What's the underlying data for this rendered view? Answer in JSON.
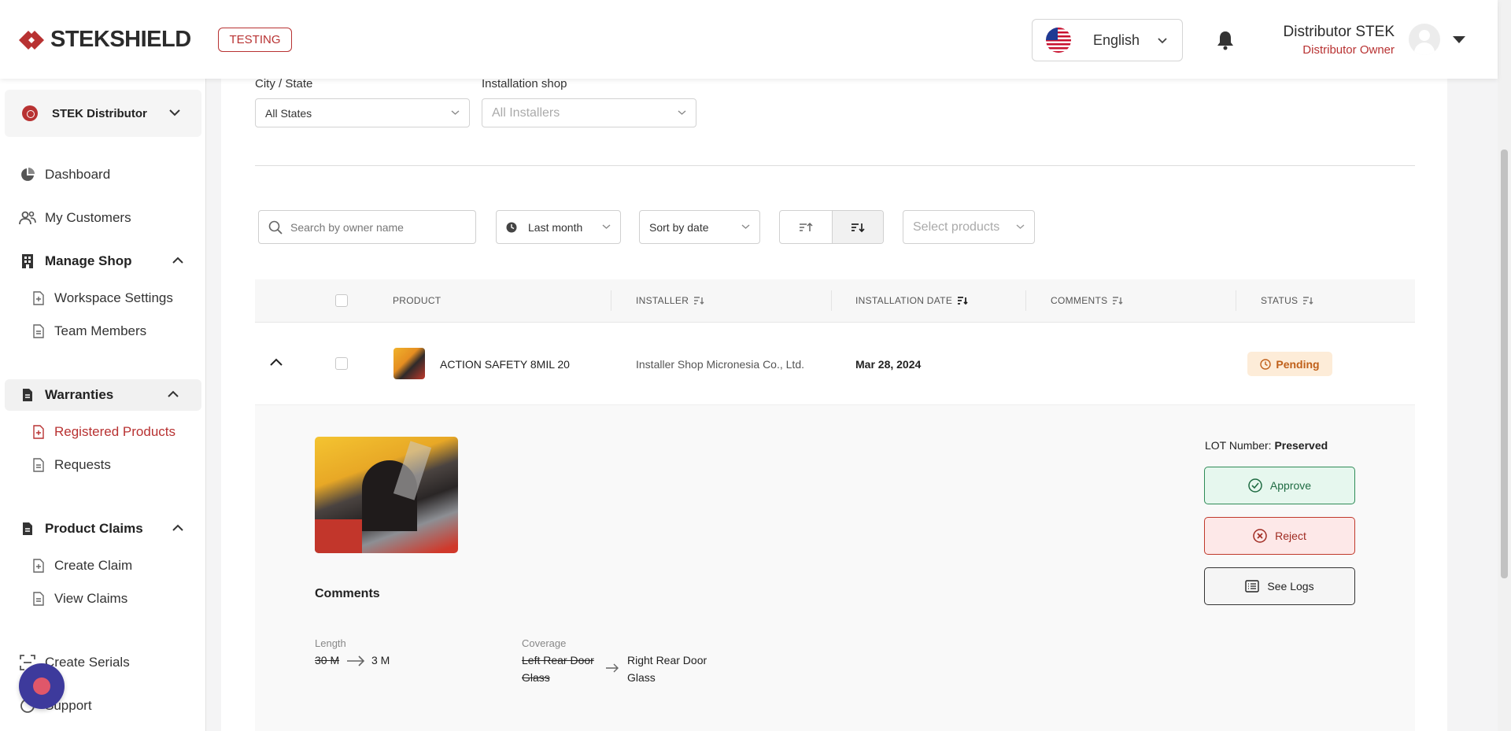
{
  "header": {
    "logo_text": "STEKSHIELD",
    "env_badge": "TESTING",
    "language": "English",
    "user_name": "Distributor STEK",
    "user_role": "Distributor Owner"
  },
  "sidebar": {
    "org_name": "STEK Distributor",
    "items": [
      {
        "label": "Dashboard",
        "icon": "pie-chart-icon"
      },
      {
        "label": "My Customers",
        "icon": "users-icon"
      },
      {
        "label": "Manage Shop",
        "icon": "building-icon"
      },
      {
        "label": "Workspace Settings",
        "icon": "file-plus-icon"
      },
      {
        "label": "Team Members",
        "icon": "file-icon"
      },
      {
        "label": "Warranties",
        "icon": "document-icon"
      },
      {
        "label": "Registered Products",
        "icon": "file-plus-icon"
      },
      {
        "label": "Requests",
        "icon": "file-icon"
      },
      {
        "label": "Product Claims",
        "icon": "document-icon"
      },
      {
        "label": "Create Claim",
        "icon": "file-plus-icon"
      },
      {
        "label": "View Claims",
        "icon": "file-icon"
      },
      {
        "label": "Create Serials",
        "icon": "scan-icon"
      },
      {
        "label": "Support",
        "icon": "help-icon"
      }
    ]
  },
  "filters": {
    "city_label": "City / State",
    "city_value": "All States",
    "shop_label": "Installation shop",
    "shop_placeholder": "All Installers",
    "search_placeholder": "Search by owner name",
    "period": "Last month",
    "sort": "Sort by date",
    "products_placeholder": "Select products"
  },
  "table": {
    "headers": [
      "PRODUCT",
      "INSTALLER",
      "INSTALLATION DATE",
      "COMMENTS",
      "STATUS"
    ],
    "row": {
      "product": "ACTION SAFETY 8MIL 20",
      "installer": "Installer Shop Micronesia Co., Ltd.",
      "date": "Mar 28, 2024",
      "status": "Pending"
    }
  },
  "detail": {
    "comments_title": "Comments",
    "length_label": "Length",
    "length_old": "30 M",
    "length_new": "3 M",
    "coverage_label": "Coverage",
    "coverage_old_1": "Left Rear Door",
    "coverage_old_2": "Glass",
    "coverage_new_1": "Right Rear Door",
    "coverage_new_2": "Glass",
    "lot_label": "LOT Number:",
    "lot_value": "Preserved",
    "approve": "Approve",
    "reject": "Reject",
    "logs": "See Logs"
  },
  "colors": {
    "brand_red": "#b83232",
    "pending_bg": "#fdecd8",
    "pending_text": "#c0601a",
    "approve_green": "#2e8b57",
    "reject_red": "#c0392b"
  }
}
